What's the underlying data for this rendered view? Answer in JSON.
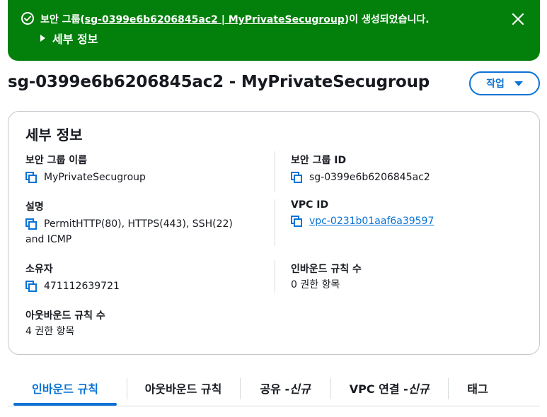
{
  "banner": {
    "prefix": "보안 그룹(",
    "link_text": "sg-0399e6b6206845ac2 | MyPrivateSecugroup",
    "suffix": ")이 생성되었습니다.",
    "details_label": "세부 정보",
    "status_color": "#037f0c"
  },
  "header": {
    "title": "sg-0399e6b6206845ac2 - MyPrivateSecugroup",
    "action_label": "작업"
  },
  "details": {
    "title": "세부 정보",
    "name_label": "보안 그룹 이름",
    "name_value": "MyPrivateSecugroup",
    "id_label": "보안 그룹 ID",
    "id_value": "sg-0399e6b6206845ac2",
    "desc_label": "설명",
    "desc_value_line1": "PermitHTTP(80), HTTPS(443), SSH(22)",
    "desc_value_line2": "and ICMP",
    "vpc_label": "VPC ID",
    "vpc_value": "vpc-0231b01aaf6a39597",
    "owner_label": "소유자",
    "owner_value": "471112639721",
    "inbound_label": "인바운드 규칙 수",
    "inbound_value": "0 권한 항목",
    "outbound_label": "아웃바운드 규칙 수",
    "outbound_value": "4 권한 항목"
  },
  "tabs": {
    "inbound": "인바운드 규칙",
    "outbound": "아웃바운드 규칙",
    "sharing": "공유 - ",
    "sharing_new": "신규",
    "vpc_assoc": "VPC 연결 - ",
    "vpc_assoc_new": "신규",
    "tags": "태그"
  },
  "colors": {
    "accent": "#0972d3",
    "success": "#037f0c"
  },
  "icons": [
    "check-circle-icon",
    "caret-right-icon",
    "close-icon",
    "caret-down-icon",
    "copy-icon"
  ]
}
